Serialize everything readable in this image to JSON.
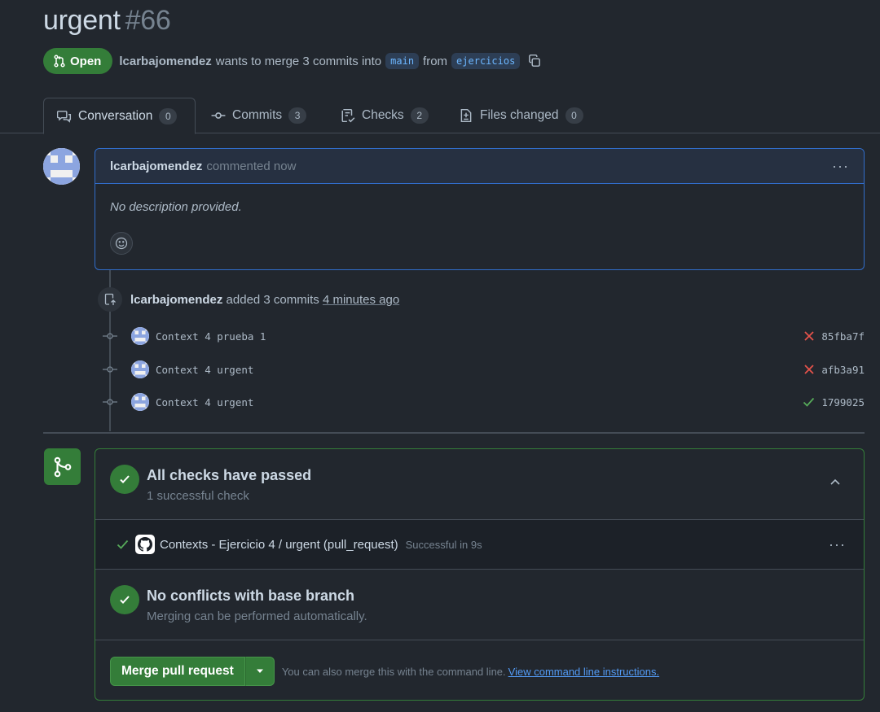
{
  "pr": {
    "title": "urgent",
    "number": "#66",
    "state": "Open",
    "author": "lcarbajomendez",
    "merge_text": "wants to merge 3 commits into",
    "base_branch": "main",
    "from_text": "from",
    "head_branch": "ejercicios"
  },
  "tabs": [
    {
      "label": "Conversation",
      "count": "0",
      "icon": "comment-discussion-icon"
    },
    {
      "label": "Commits",
      "count": "3",
      "icon": "git-commit-icon"
    },
    {
      "label": "Checks",
      "count": "2",
      "icon": "checklist-icon"
    },
    {
      "label": "Files changed",
      "count": "0",
      "icon": "file-diff-icon"
    }
  ],
  "comment": {
    "author": "lcarbajomendez",
    "when": "commented now",
    "body": "No description provided."
  },
  "push_event": {
    "author": "lcarbajomendez",
    "text": "added 3 commits",
    "ago": "4 minutes ago"
  },
  "commits": [
    {
      "message": "Context 4 prueba 1",
      "status": "failed",
      "sha": "85fba7f"
    },
    {
      "message": "Context 4 urgent",
      "status": "failed",
      "sha": "afb3a91"
    },
    {
      "message": "Context 4 urgent",
      "status": "success",
      "sha": "1799025"
    }
  ],
  "merge_box": {
    "checks_title": "All checks have passed",
    "checks_sub": "1 successful check",
    "check_item_name": "Contexts - Ejercicio 4 / urgent (pull_request)",
    "check_item_status": "Successful in 9s",
    "conflicts_title": "No conflicts with base branch",
    "conflicts_sub": "Merging can be performed automatically.",
    "merge_button": "Merge pull request",
    "hint_text": "You can also merge this with the command line.",
    "hint_link": "View command line instructions."
  },
  "colors": {
    "background": "#22272e",
    "success": "#347d39",
    "danger": "#e5534b",
    "accent": "#539bf5"
  }
}
